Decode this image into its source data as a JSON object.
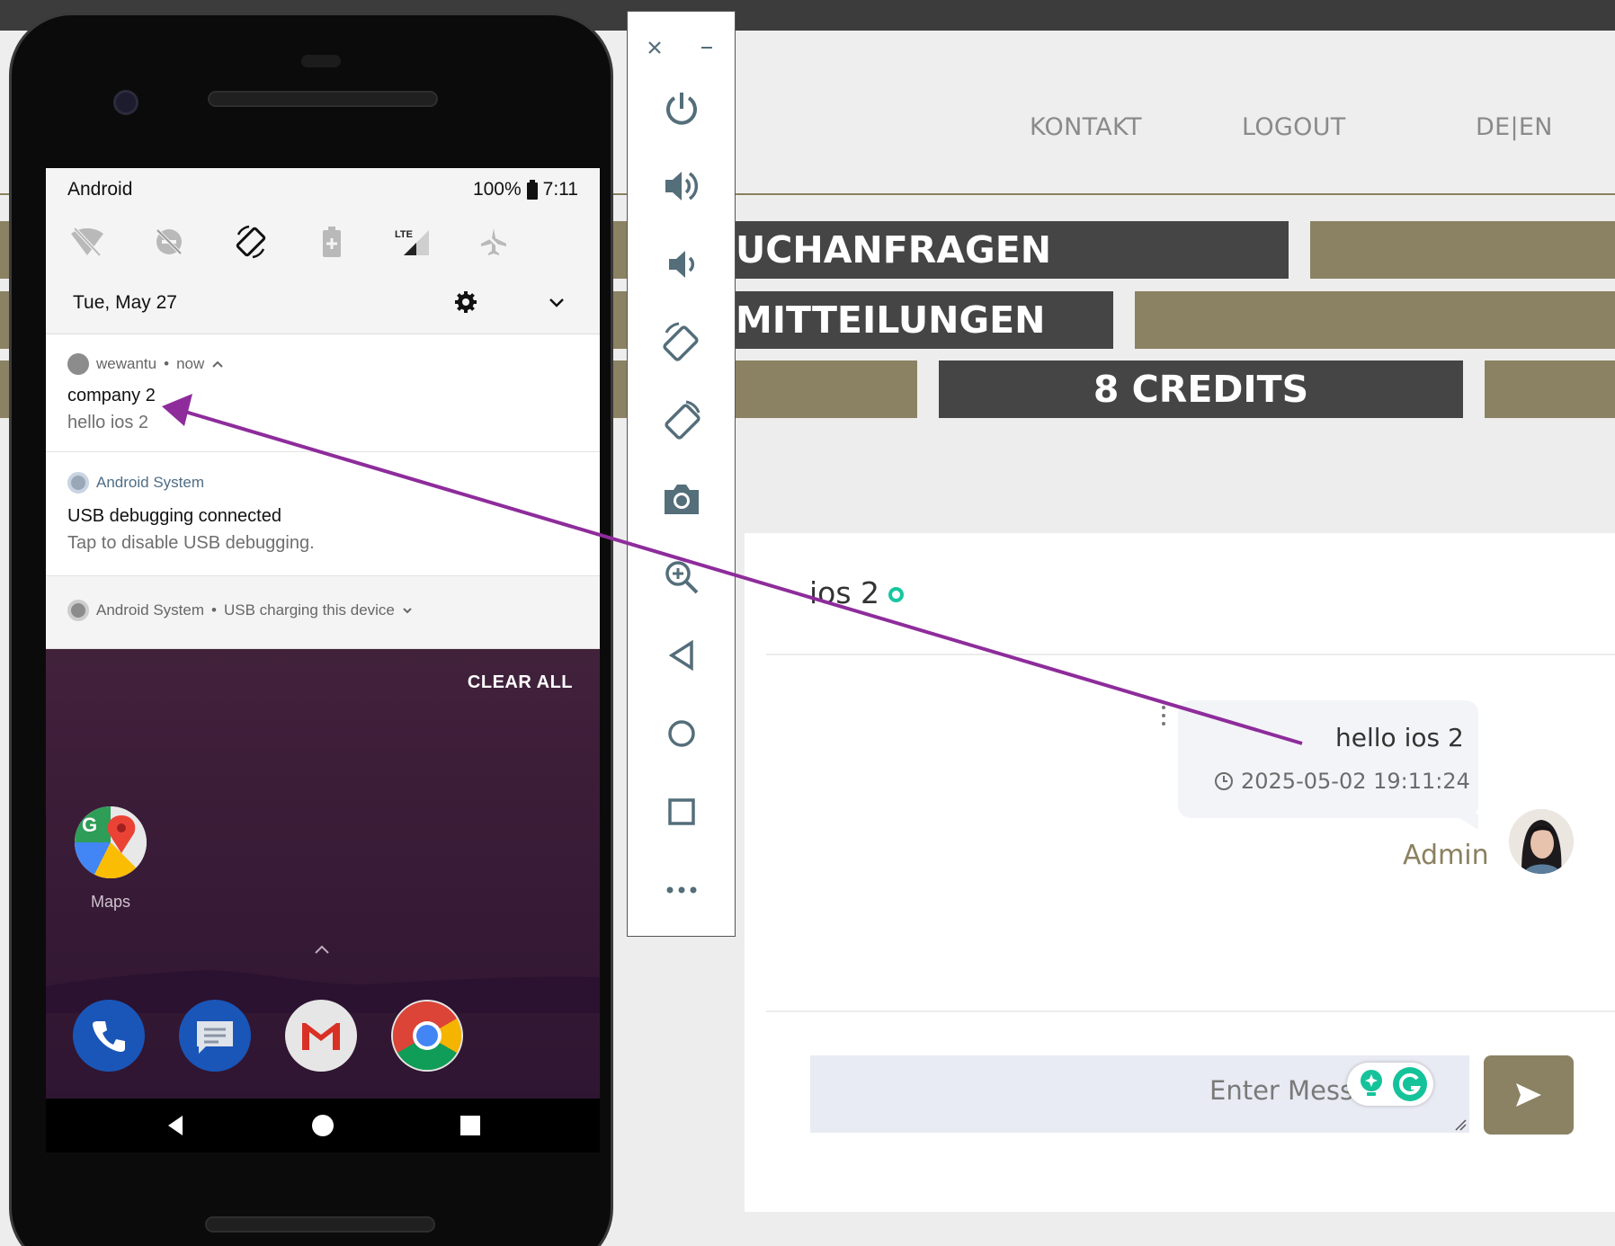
{
  "website": {
    "nav": {
      "contact": "KONTAKT",
      "logout": "LOGOUT",
      "language": "DE|EN"
    },
    "bands": {
      "requests": "UCHANFRAGEN",
      "messages": "MITTEILUNGEN",
      "credits": "8 CREDITS"
    },
    "chat": {
      "contact_name": "ios 2",
      "message": {
        "text": "hello ios 2",
        "timestamp": "2025-05-02 19:11:24",
        "sender": "Admin"
      },
      "input_placeholder": "Enter Message",
      "input_visible_text": "Enter Mess"
    }
  },
  "emulator_sidebar": {
    "buttons": [
      "close-icon",
      "minimize-icon",
      "power-icon",
      "volume-up-icon",
      "volume-down-icon",
      "rotate-left-icon",
      "rotate-right-icon",
      "camera-icon",
      "zoom-icon",
      "back-icon",
      "home-icon",
      "overview-icon",
      "more-icon"
    ]
  },
  "phone": {
    "status": {
      "carrier": "Android",
      "battery": "100%",
      "time": "7:11"
    },
    "quick_settings": {
      "tiles": [
        "wifi-off-icon",
        "dnd-icon",
        "auto-rotate-icon",
        "battery-saver-icon",
        "lte-signal-icon",
        "airplane-mode-icon"
      ],
      "lte_label": "LTE",
      "date": "Tue, May 27"
    },
    "notifications": [
      {
        "app": "wewantu",
        "when": "now",
        "title": "company 2",
        "text": "hello ios 2"
      },
      {
        "app": "Android System",
        "title": "USB debugging connected",
        "text": "Tap to disable USB debugging."
      },
      {
        "app": "Android System",
        "summary": "USB charging this device"
      }
    ],
    "clear_all": "CLEAR ALL",
    "home": {
      "maps_label": "Maps",
      "dock": [
        "phone-app-icon",
        "messages-app-icon",
        "gmail-app-icon",
        "chrome-app-icon"
      ]
    }
  },
  "annotation": {
    "color": "#8e2c9b"
  },
  "colors": {
    "olive": "#8b8263",
    "dark_band": "#454545",
    "online": "#16c7a0"
  }
}
